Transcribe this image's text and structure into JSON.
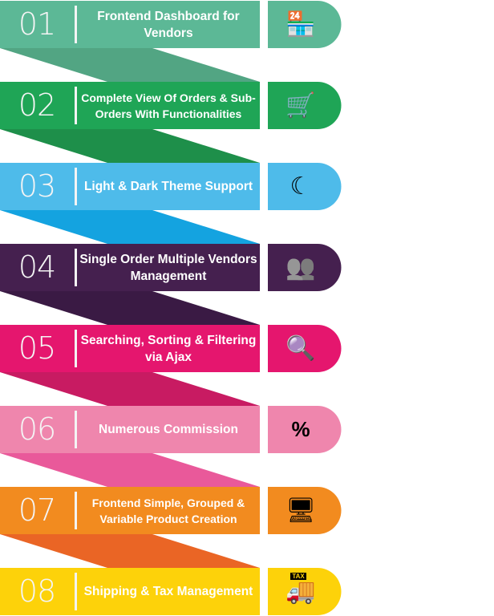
{
  "items": [
    {
      "number": "01",
      "label": "Frontend Dashboard for Vendors",
      "icon": "store-icon",
      "color": "#5cb896",
      "ribbon": "#52a583"
    },
    {
      "number": "02",
      "label": "Complete View Of Orders & Sub-Orders With Functionalities",
      "icon": "order-cart-icon",
      "color": "#1fa556",
      "ribbon": "#1e8f4a"
    },
    {
      "number": "03",
      "label": "Light & Dark Theme Support",
      "icon": "day-night-icon",
      "color": "#4ebbea",
      "ribbon": "#14a3e0"
    },
    {
      "number": "04",
      "label": "Single Order Multiple Vendors Management",
      "icon": "vendors-icon",
      "color": "#45204f",
      "ribbon": "#3a1a44"
    },
    {
      "number": "05",
      "label": "Searching, Sorting & Filtering via Ajax",
      "icon": "search-filter-icon",
      "color": "#e5166e",
      "ribbon": "#c81b62"
    },
    {
      "number": "06",
      "label": "Numerous Commission",
      "icon": "commission-icon",
      "color": "#ef86ad",
      "ribbon": "#e9599a"
    },
    {
      "number": "07",
      "label": "Frontend Simple, Grouped & Variable Product Creation",
      "icon": "product-screen-icon",
      "color": "#f28b1f",
      "ribbon": "#ea6525"
    },
    {
      "number": "08",
      "label": "Shipping & Tax Management",
      "icon": "tax-truck-icon",
      "color": "#fdd20a",
      "ribbon": "#fdd20a"
    }
  ],
  "tax_icon_text": "TAX"
}
